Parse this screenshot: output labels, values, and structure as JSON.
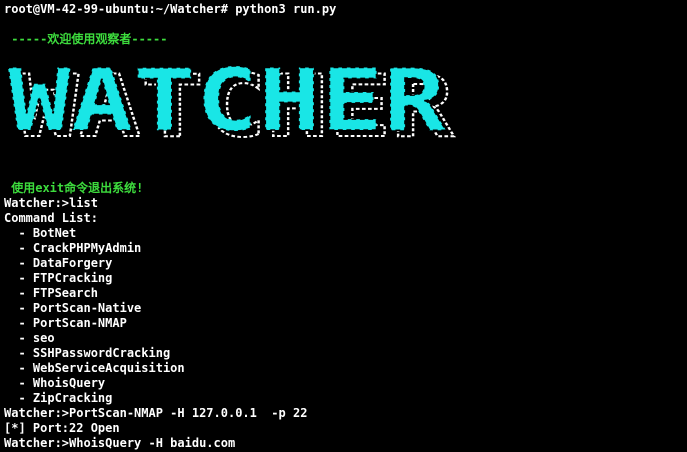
{
  "terminal": {
    "prompt_line": "root@VM-42-99-ubuntu:~/Watcher# python3 run.py",
    "welcome": " -----欢迎使用观察者-----",
    "banner": {
      "text": "WATCHER",
      "color": "#19e6e6",
      "shadow_color": "#ffffff"
    },
    "exit_hint": " 使用exit命令退出系统!",
    "list_cmd": "Watcher:>list",
    "command_list_header": "Command List:",
    "commands": [
      "  - BotNet",
      "  - CrackPHPMyAdmin",
      "  - DataForgery",
      "  - FTPCracking",
      "  - FTPSearch",
      "  - PortScan-Native",
      "  - PortScan-NMAP",
      "  - seo",
      "  - SSHPasswordCracking",
      "  - WebServiceAcquisition",
      "  - WhoisQuery",
      "  - ZipCracking"
    ],
    "portscan_cmd": "Watcher:>PortScan-NMAP -H 127.0.0.1  -p 22",
    "portscan_result": "[*] Port:22 Open",
    "whois_cmd": "Watcher:>WhoisQuery -H baidu.com"
  },
  "colors": {
    "background": "#000000",
    "text": "#ffffff",
    "green": "#3ddc3d"
  }
}
